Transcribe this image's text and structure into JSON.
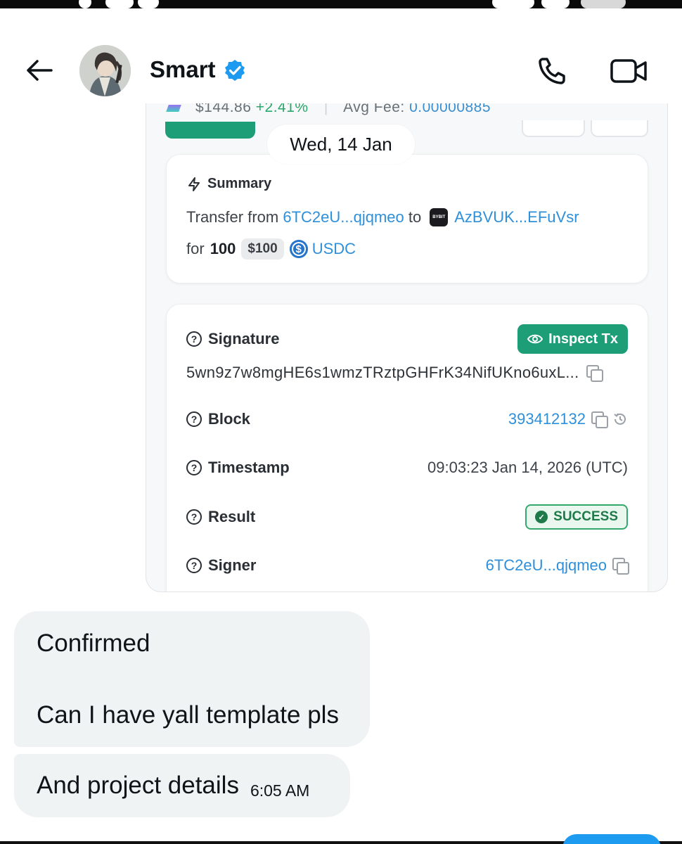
{
  "header": {
    "contact_name": "Smart",
    "back_icon": "arrow-left-icon",
    "verified_icon": "verified-badge-icon",
    "call_icon": "phone-icon",
    "video_icon": "video-camera-icon"
  },
  "attachment": {
    "cropped_stats": {
      "price": "$144.86",
      "change": "+2.41%",
      "avg_fee_label": "Avg Fee:",
      "avg_fee_value": "0.00000885"
    },
    "summary": {
      "title": "Summary",
      "transfer_from_label": "Transfer from",
      "from_address": "6TC2eU...qjqmeo",
      "to_label": "to",
      "to_logo_text": "BYBIT",
      "to_address": "AzBVUK...EFuVsr",
      "for_label": "for",
      "amount": "100",
      "usd_value": "$100",
      "token": "USDC"
    },
    "details": {
      "signature_label": "Signature",
      "inspect_button": "Inspect Tx",
      "signature_value": "5wn9z7w8mgHE6s1wmzTRztpGHFrK34NifUKno6uxL...",
      "block_label": "Block",
      "block_value": "393412132",
      "timestamp_label": "Timestamp",
      "timestamp_value": "09:03:23 Jan 14, 2026 (UTC)",
      "result_label": "Result",
      "result_value": "SUCCESS",
      "signer_label": "Signer",
      "signer_value": "6TC2eU...qjqmeo"
    }
  },
  "date_separator": "Wed, 14 Jan",
  "messages": [
    {
      "line1": "Confirmed",
      "line2": "Can I have yall template pls"
    },
    {
      "text": "And project details",
      "time": "6:05 AM"
    }
  ],
  "colors": {
    "accent_green": "#1e9e77",
    "link_blue": "#2f8fd8",
    "verified_blue": "#1d9bf0",
    "bubble_bg": "#eff3f4"
  }
}
